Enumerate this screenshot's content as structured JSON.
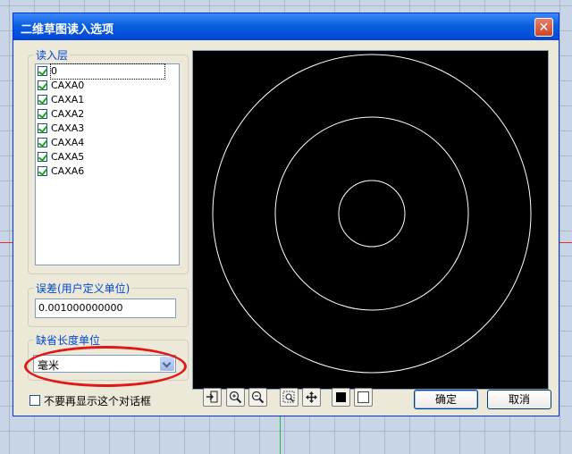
{
  "window": {
    "title": "二维草图读入选项",
    "close": "✕"
  },
  "layers": {
    "legend": "读入层",
    "items": [
      "0",
      "CAXA0",
      "CAXA1",
      "CAXA2",
      "CAXA3",
      "CAXA4",
      "CAXA5",
      "CAXA6"
    ],
    "checked": [
      true,
      true,
      true,
      true,
      true,
      true,
      true,
      true
    ]
  },
  "tolerance": {
    "legend": "误差(用户定义单位)",
    "value": "0.001000000000"
  },
  "unit": {
    "legend": "缺省长度单位",
    "selected": "毫米"
  },
  "dont_show": {
    "label": "不要再显示这个对话框",
    "checked": false
  },
  "preview": {
    "background": "#000000",
    "line_color": "#ffffff",
    "circles": 3
  },
  "toolbar": {
    "icons": [
      "import-icon",
      "zoom-in-icon",
      "zoom-out-icon",
      "zoom-window-icon",
      "pan-icon",
      "black-bg-icon",
      "white-bg-icon"
    ]
  },
  "buttons": {
    "ok": "确定",
    "cancel": "取消"
  },
  "annotation": {
    "color": "#e01818"
  }
}
